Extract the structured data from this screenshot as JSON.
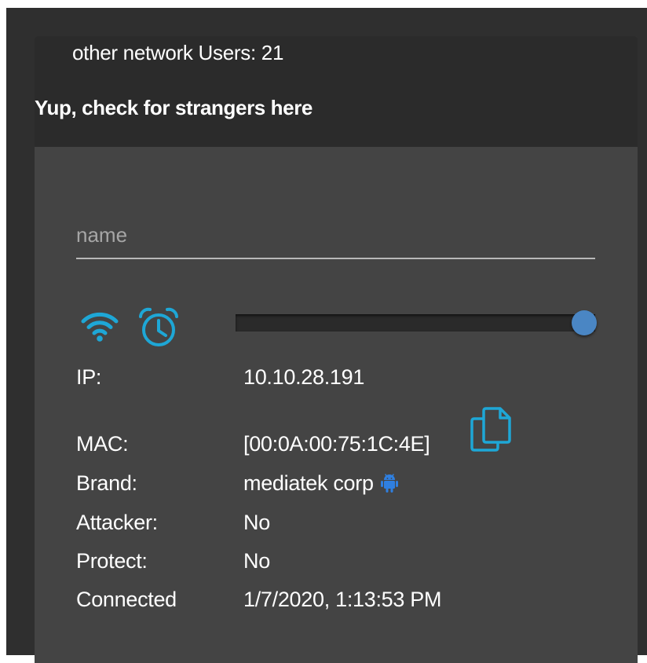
{
  "header": {
    "users_line": "other network Users: 21",
    "tagline": "Yup, check for strangers here"
  },
  "name_input": {
    "placeholder": "name",
    "value": ""
  },
  "icons": {
    "wifi": "wifi-icon",
    "alarm": "alarm-clock-icon",
    "copy": "copy-icon",
    "android": "android-icon"
  },
  "slider": {
    "value_percent": 97
  },
  "device": {
    "ip": {
      "label": "IP:",
      "value": "10.10.28.191"
    },
    "mac": {
      "label": "MAC:",
      "value": "[00:0A:00:75:1C:4E]"
    },
    "brand": {
      "label": "Brand:",
      "value": "mediatek corp"
    },
    "attacker": {
      "label": "Attacker:",
      "value": "No"
    },
    "protect": {
      "label": "Protect:",
      "value": "No"
    },
    "connected": {
      "label": "Connected",
      "value": "1/7/2020, 1:13:53 PM"
    }
  },
  "colors": {
    "accent": "#1ea7d6",
    "slider_thumb": "#4a86c4",
    "android": "#2f7fe0",
    "panel_bg": "#444444",
    "header_bg": "#2b2b2b"
  }
}
